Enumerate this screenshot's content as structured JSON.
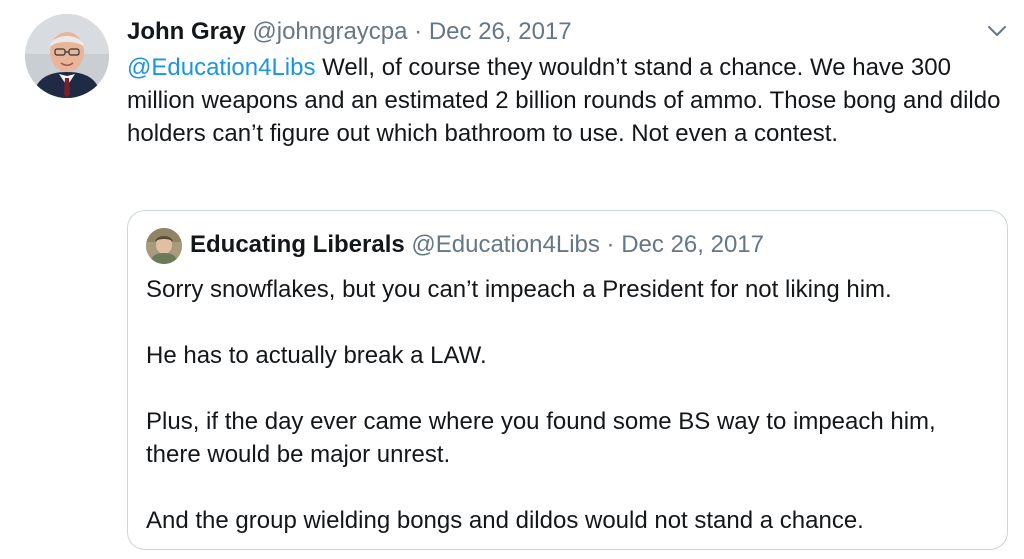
{
  "tweet": {
    "author_name": "John Gray",
    "author_handle": "@johngraycpa",
    "separator": "·",
    "date": "Dec 26, 2017",
    "mention": "@Education4Libs",
    "text": " Well, of course they wouldn’t stand a chance. We have 300 million weapons and an estimated 2 billion rounds of ammo. Those bong and dildo holders can’t figure out which bathroom to use. Not even a contest.",
    "menu_icon": "chevron-down-icon"
  },
  "quoted_tweet": {
    "author_name": "Educating Liberals",
    "author_handle": "@Education4Libs",
    "separator": "·",
    "date": "Dec 26, 2017",
    "paragraphs": [
      "Sorry snowflakes, but you can’t impeach a President for not liking him.",
      "He has to actually break a LAW.",
      "Plus, if the day ever came where you found some BS way to impeach him, there would be major unrest.",
      "And the group wielding bongs and dildos would not stand a chance."
    ]
  },
  "colors": {
    "text": "#14171a",
    "secondary": "#657786",
    "link": "#1b95e0",
    "border": "#ccd6dd"
  }
}
